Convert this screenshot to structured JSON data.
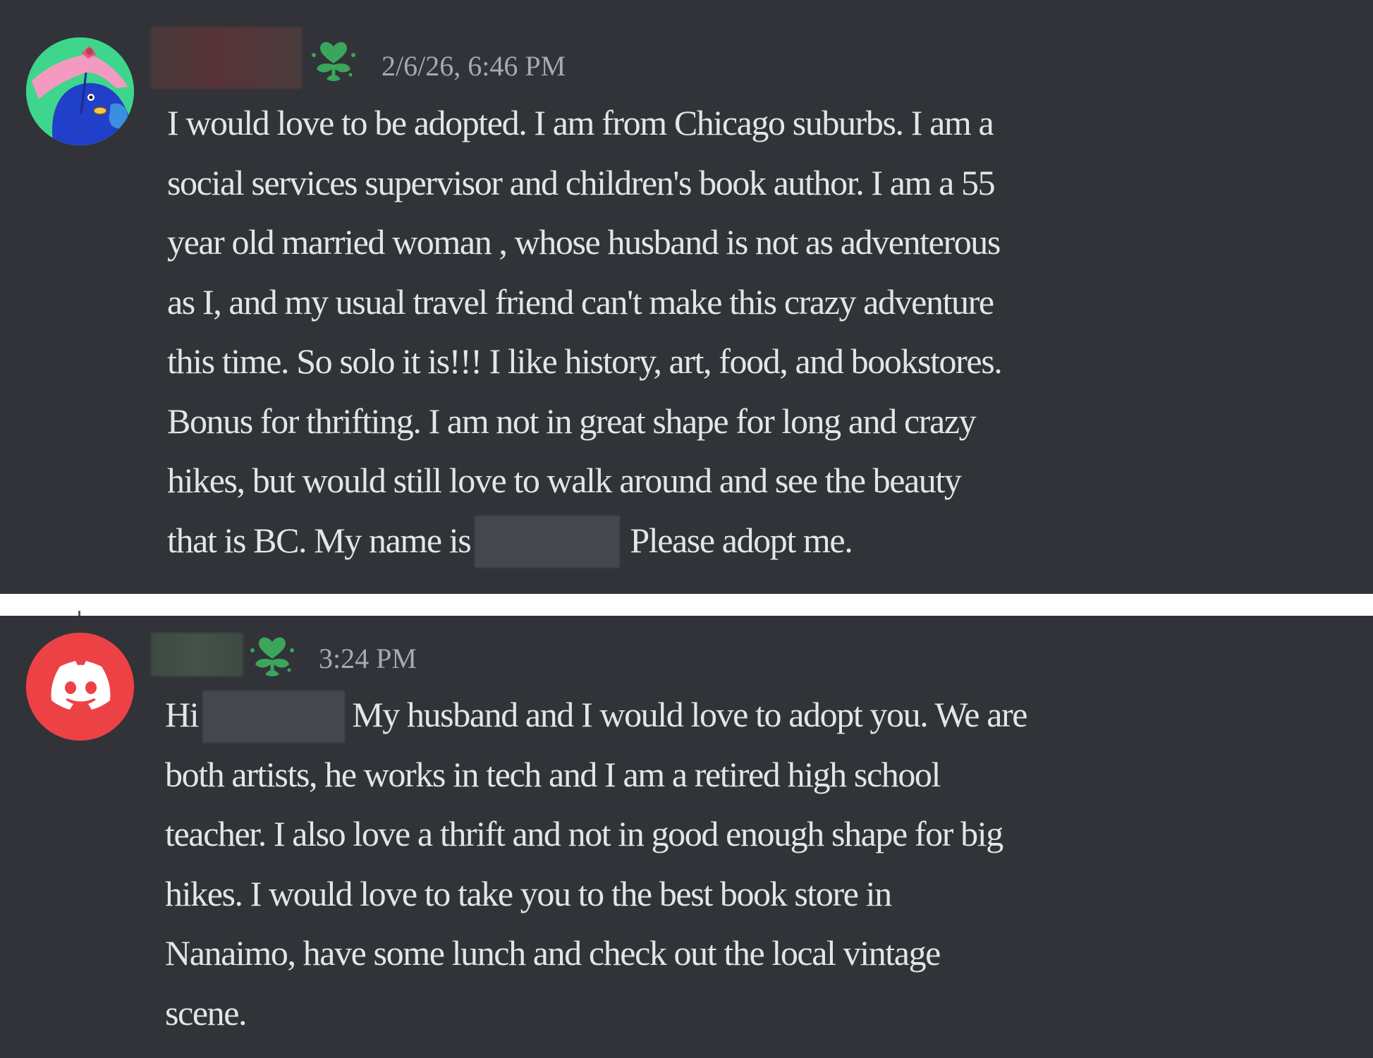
{
  "messages": [
    {
      "author": "",
      "badge_icon": "flower-heart-icon",
      "avatar_icon": "bird-avatar-icon",
      "timestamp": "2/6/26, 6:46 PM",
      "lines": [
        "I would love to be adopted. I am from Chicago suburbs. I am a",
        "social services supervisor and children's book author.  I am a 55",
        "year old married woman , whose husband is not as adventerous",
        "as I, and my usual travel friend can't make this crazy adventure",
        "this time. So solo it is!!! I like history, art, food, and bookstores.",
        "Bonus for thrifting. I am not in great shape for long and crazy",
        "hikes, but would still love to walk around and see the beauty"
      ],
      "last_line_before": "that is BC.  My name is",
      "last_line_after": "Please adopt me."
    },
    {
      "author": "",
      "badge_icon": "flower-heart-icon",
      "avatar_icon": "discord-logo-icon",
      "timestamp": "3:24 PM",
      "first_line_before": "Hi",
      "first_line_after": "My husband and I would love to adopt you.  We are",
      "lines": [
        "both artists, he works in tech and I am a retired high school",
        "teacher.  I also love a thrift and not in good enough shape for big",
        "hikes.  I would love to take you to the best book store in",
        "Nanaimo, have some lunch and check out the local vintage",
        "scene."
      ]
    }
  ],
  "colors": {
    "background": "#313338",
    "text": "#e3e5e8",
    "timestamp": "#a7aab0",
    "badge": "#3ba55c",
    "discord_red": "#ed4245"
  }
}
